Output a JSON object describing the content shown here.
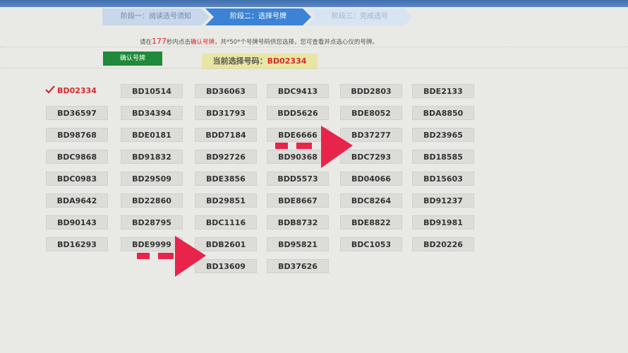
{
  "steps": [
    {
      "label": "阶段一：阅读选号须知"
    },
    {
      "label": "阶段二：选择号牌"
    },
    {
      "label": "阶段三：完成选号"
    }
  ],
  "instruction": {
    "prefix": "请在",
    "seconds": "177",
    "middle": "秒内点击",
    "action": "确认号牌",
    "suffix": "，共*50*个号牌号码供您选择，您可查看并点选心仪的号牌。"
  },
  "confirm_label": "确认号牌",
  "current": {
    "label": "当前选择号码：",
    "value": "BD02334"
  },
  "plates": [
    [
      "BD02334",
      "BD10514",
      "BD36063",
      "BDC9413",
      "BDD2803",
      "BDE2133"
    ],
    [
      "BD36597",
      "BD34394",
      "BD31793",
      "BDD5626",
      "BDE8052",
      "BDA8850"
    ],
    [
      "BD98768",
      "BDE0181",
      "BDD7184",
      "BDE6666",
      "BD37277",
      "BD23965"
    ],
    [
      "BDC9868",
      "BD91832",
      "BD92726",
      "BD90368",
      "BDC7293",
      "BD18585"
    ],
    [
      "BDC0983",
      "BD29509",
      "BDE3856",
      "BDD5573",
      "BD04066",
      "BD15603"
    ],
    [
      "BDA9642",
      "BD22860",
      "BD29851",
      "BDE8667",
      "BDC8264",
      "BD91237"
    ],
    [
      "BD90143",
      "BD28795",
      "BDC1116",
      "BDB8732",
      "BDE8822",
      "BD91981"
    ],
    [
      "BD16293",
      "BDE9999",
      "BDB2601",
      "BD95821",
      "BDC1053",
      "BD20226"
    ],
    [
      "BD13609",
      "BD37626"
    ]
  ],
  "selected": "BD02334",
  "colors": {
    "accent": "#3c82d6",
    "confirm": "#1e8a3a",
    "highlight": "#d42a2a",
    "arrow": "#e8244a"
  }
}
